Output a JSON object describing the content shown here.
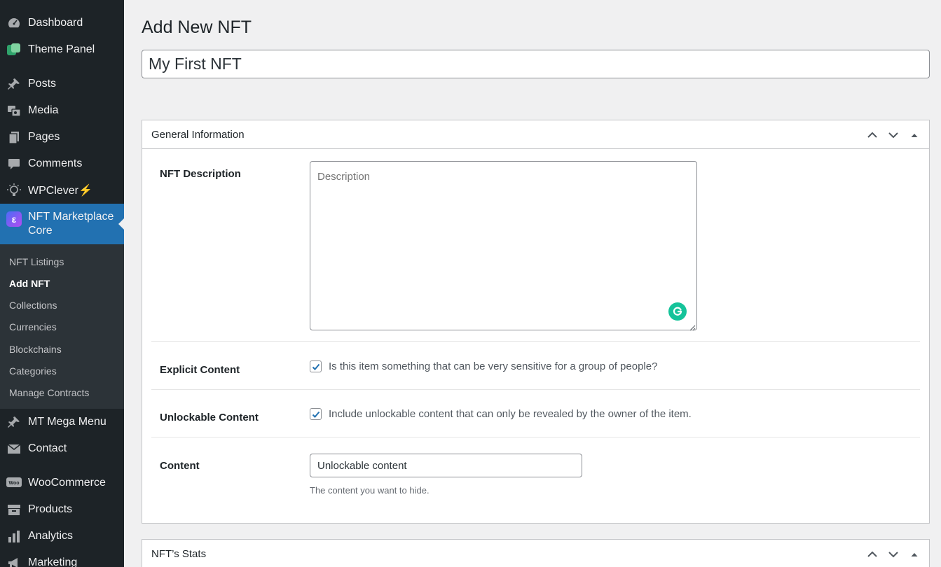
{
  "sidebar": {
    "items": [
      {
        "label": "Dashboard",
        "icon": "dashboard-icon"
      },
      {
        "label": "Theme Panel",
        "icon": "theme-panel-icon"
      },
      {
        "label": "Posts",
        "icon": "pin-icon"
      },
      {
        "label": "Media",
        "icon": "media-icon"
      },
      {
        "label": "Pages",
        "icon": "pages-icon"
      },
      {
        "label": "Comments",
        "icon": "comment-icon"
      },
      {
        "label": "WPClever⚡",
        "icon": "lightbulb-icon"
      },
      {
        "label": "NFT Marketplace Core",
        "icon": "nft-core-icon"
      },
      {
        "label": "MT Mega Menu",
        "icon": "pin-icon"
      },
      {
        "label": "Contact",
        "icon": "mail-icon"
      },
      {
        "label": "WooCommerce",
        "icon": "woo-icon"
      },
      {
        "label": "Products",
        "icon": "archive-icon"
      },
      {
        "label": "Analytics",
        "icon": "bar-chart-icon"
      },
      {
        "label": "Marketing",
        "icon": "megaphone-icon"
      }
    ],
    "submenu": [
      "NFT Listings",
      "Add NFT",
      "Collections",
      "Currencies",
      "Blockchains",
      "Categories",
      "Manage Contracts"
    ],
    "accent": "#2271b1"
  },
  "page": {
    "title": "Add New NFT",
    "post_title": "My First NFT"
  },
  "general_box": {
    "title": "General Information",
    "description_label": "NFT Description",
    "description_placeholder": "Description",
    "explicit_label": "Explicit Content",
    "explicit_text": "Is this item something that can be very sensitive for a group of people?",
    "explicit_checked": true,
    "unlockable_label": "Unlockable Content",
    "unlockable_text": "Include unlockable content that can only be revealed by the owner of the item.",
    "unlockable_checked": true,
    "content_label": "Content",
    "content_value": "Unlockable content",
    "content_help": "The content you want to hide."
  },
  "stats_box": {
    "title": "NFT’s Stats"
  }
}
